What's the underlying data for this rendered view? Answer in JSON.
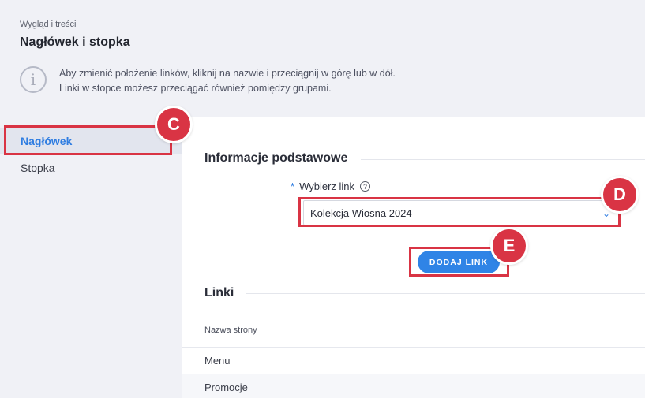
{
  "breadcrumb": "Wygląd i treści",
  "page_title": "Nagłówek i stopka",
  "info": {
    "line1": "Aby zmienić położenie linków, kliknij na nazwie i przeciągnij w górę lub w dół.",
    "line2": "Linki w stopce możesz przeciągać również pomiędzy grupami."
  },
  "sidebar": {
    "items": [
      {
        "label": "Nagłówek"
      },
      {
        "label": "Stopka"
      }
    ]
  },
  "section_basic": {
    "title": "Informacje podstawowe",
    "required_mark": "*",
    "field_label": "Wybierz link",
    "selected_value": "Kolekcja Wiosna 2024",
    "add_button": "DODAJ LINK"
  },
  "section_links": {
    "title": "Linki",
    "column_header": "Nazwa strony",
    "rows": [
      {
        "name": "Menu"
      },
      {
        "name": "Promocje"
      }
    ]
  },
  "callouts": {
    "c": "C",
    "d": "D",
    "e": "E"
  },
  "colors": {
    "accent": "#2f84e6",
    "callout": "#d93444"
  }
}
